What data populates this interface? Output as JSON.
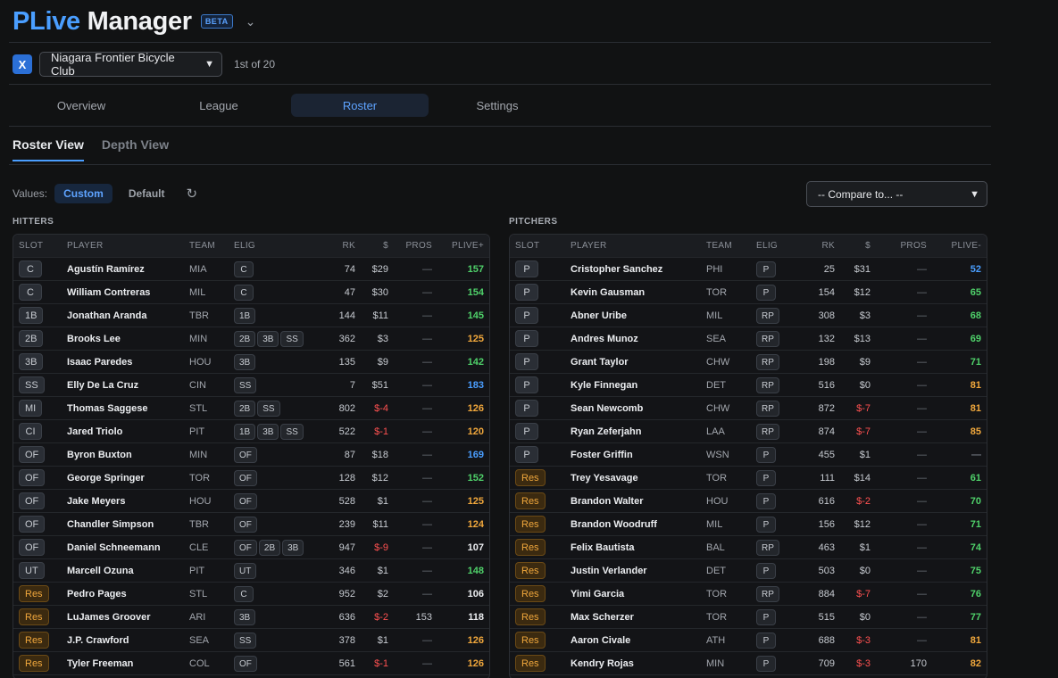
{
  "app": {
    "title_part1": "PLive",
    "title_part2": "Manager",
    "badge": "BETA"
  },
  "league": {
    "icon": "X",
    "name": "Niagara Frontier Bicycle Club",
    "rank": "1st of 20"
  },
  "tabs": [
    "Overview",
    "League",
    "Roster",
    "Settings"
  ],
  "active_tab": "Roster",
  "subtabs": [
    "Roster View",
    "Depth View"
  ],
  "values": {
    "label": "Values:",
    "custom": "Custom",
    "default": "Default"
  },
  "compare": {
    "label": "-- Compare to... --"
  },
  "hitters": {
    "title": "HITTERS",
    "headers": [
      "SLOT",
      "PLAYER",
      "TEAM",
      "ELIG",
      "RK",
      "$",
      "PROS",
      "PLIVE+"
    ],
    "rows": [
      {
        "slot": "C",
        "player": "Agustín Ramírez",
        "team": "MIA",
        "elig": [
          "C"
        ],
        "rk": "74",
        "price": "$29",
        "pros": "—",
        "plive": "157",
        "color": "#4fd16a"
      },
      {
        "slot": "C",
        "player": "William Contreras",
        "team": "MIL",
        "elig": [
          "C"
        ],
        "rk": "47",
        "price": "$30",
        "pros": "—",
        "plive": "154",
        "color": "#4fd16a"
      },
      {
        "slot": "1B",
        "player": "Jonathan Aranda",
        "team": "TBR",
        "elig": [
          "1B"
        ],
        "rk": "144",
        "price": "$11",
        "pros": "—",
        "plive": "145",
        "color": "#4fd16a"
      },
      {
        "slot": "2B",
        "player": "Brooks Lee",
        "team": "MIN",
        "elig": [
          "2B",
          "3B",
          "SS"
        ],
        "rk": "362",
        "price": "$3",
        "pros": "—",
        "plive": "125",
        "color": "#f0a73c"
      },
      {
        "slot": "3B",
        "player": "Isaac Paredes",
        "team": "HOU",
        "elig": [
          "3B"
        ],
        "rk": "135",
        "price": "$9",
        "pros": "—",
        "plive": "142",
        "color": "#4fd16a"
      },
      {
        "slot": "SS",
        "player": "Elly De La Cruz",
        "team": "CIN",
        "elig": [
          "SS"
        ],
        "rk": "7",
        "price": "$51",
        "pros": "—",
        "plive": "183",
        "color": "#4a9eff"
      },
      {
        "slot": "MI",
        "player": "Thomas Saggese",
        "team": "STL",
        "elig": [
          "2B",
          "SS"
        ],
        "rk": "802",
        "price": "$-4",
        "pros": "—",
        "plive": "126",
        "color": "#f0a73c"
      },
      {
        "slot": "CI",
        "player": "Jared Triolo",
        "team": "PIT",
        "elig": [
          "1B",
          "3B",
          "SS"
        ],
        "rk": "522",
        "price": "$-1",
        "pros": "—",
        "plive": "120",
        "color": "#f0a73c"
      },
      {
        "slot": "OF",
        "player": "Byron Buxton",
        "team": "MIN",
        "elig": [
          "OF"
        ],
        "rk": "87",
        "price": "$18",
        "pros": "—",
        "plive": "169",
        "color": "#4a9eff"
      },
      {
        "slot": "OF",
        "player": "George Springer",
        "team": "TOR",
        "elig": [
          "OF"
        ],
        "rk": "128",
        "price": "$12",
        "pros": "—",
        "plive": "152",
        "color": "#4fd16a"
      },
      {
        "slot": "OF",
        "player": "Jake Meyers",
        "team": "HOU",
        "elig": [
          "OF"
        ],
        "rk": "528",
        "price": "$1",
        "pros": "—",
        "plive": "125",
        "color": "#f0a73c"
      },
      {
        "slot": "OF",
        "player": "Chandler Simpson",
        "team": "TBR",
        "elig": [
          "OF"
        ],
        "rk": "239",
        "price": "$11",
        "pros": "—",
        "plive": "124",
        "color": "#f0a73c"
      },
      {
        "slot": "OF",
        "player": "Daniel Schneemann",
        "team": "CLE",
        "elig": [
          "OF",
          "2B",
          "3B"
        ],
        "rk": "947",
        "price": "$-9",
        "pros": "—",
        "plive": "107",
        "color": "#eceef1"
      },
      {
        "slot": "UT",
        "player": "Marcell Ozuna",
        "team": "PIT",
        "elig": [
          "UT"
        ],
        "rk": "346",
        "price": "$1",
        "pros": "—",
        "plive": "148",
        "color": "#4fd16a"
      },
      {
        "slot": "Res",
        "player": "Pedro Pages",
        "team": "STL",
        "elig": [
          "C"
        ],
        "rk": "952",
        "price": "$2",
        "pros": "—",
        "plive": "106",
        "color": "#eceef1"
      },
      {
        "slot": "Res",
        "player": "LuJames Groover",
        "team": "ARI",
        "elig": [
          "3B"
        ],
        "rk": "636",
        "price": "$-2",
        "pros": "153",
        "plive": "118",
        "color": "#eceef1"
      },
      {
        "slot": "Res",
        "player": "J.P. Crawford",
        "team": "SEA",
        "elig": [
          "SS"
        ],
        "rk": "378",
        "price": "$1",
        "pros": "—",
        "plive": "126",
        "color": "#f0a73c"
      },
      {
        "slot": "Res",
        "player": "Tyler Freeman",
        "team": "COL",
        "elig": [
          "OF"
        ],
        "rk": "561",
        "price": "$-1",
        "pros": "—",
        "plive": "126",
        "color": "#f0a73c"
      }
    ]
  },
  "pitchers": {
    "title": "PITCHERS",
    "headers": [
      "SLOT",
      "PLAYER",
      "TEAM",
      "ELIG",
      "RK",
      "$",
      "PROS",
      "PLIVE-"
    ],
    "rows": [
      {
        "slot": "P",
        "player": "Cristopher Sanchez",
        "team": "PHI",
        "elig": [
          "P"
        ],
        "rk": "25",
        "price": "$31",
        "pros": "—",
        "plive": "52",
        "color": "#4a9eff"
      },
      {
        "slot": "P",
        "player": "Kevin Gausman",
        "team": "TOR",
        "elig": [
          "P"
        ],
        "rk": "154",
        "price": "$12",
        "pros": "—",
        "plive": "65",
        "color": "#4fd16a"
      },
      {
        "slot": "P",
        "player": "Abner Uribe",
        "team": "MIL",
        "elig": [
          "RP"
        ],
        "rk": "308",
        "price": "$3",
        "pros": "—",
        "plive": "68",
        "color": "#4fd16a"
      },
      {
        "slot": "P",
        "player": "Andres Munoz",
        "team": "SEA",
        "elig": [
          "RP"
        ],
        "rk": "132",
        "price": "$13",
        "pros": "—",
        "plive": "69",
        "color": "#4fd16a"
      },
      {
        "slot": "P",
        "player": "Grant Taylor",
        "team": "CHW",
        "elig": [
          "RP"
        ],
        "rk": "198",
        "price": "$9",
        "pros": "—",
        "plive": "71",
        "color": "#4fd16a"
      },
      {
        "slot": "P",
        "player": "Kyle Finnegan",
        "team": "DET",
        "elig": [
          "RP"
        ],
        "rk": "516",
        "price": "$0",
        "pros": "—",
        "plive": "81",
        "color": "#f0a73c"
      },
      {
        "slot": "P",
        "player": "Sean Newcomb",
        "team": "CHW",
        "elig": [
          "RP"
        ],
        "rk": "872",
        "price": "$-7",
        "pros": "—",
        "plive": "81",
        "color": "#f0a73c"
      },
      {
        "slot": "P",
        "player": "Ryan Zeferjahn",
        "team": "LAA",
        "elig": [
          "RP"
        ],
        "rk": "874",
        "price": "$-7",
        "pros": "—",
        "plive": "85",
        "color": "#f0a73c"
      },
      {
        "slot": "P",
        "player": "Foster Griffin",
        "team": "WSN",
        "elig": [
          "P"
        ],
        "rk": "455",
        "price": "$1",
        "pros": "—",
        "plive": "—",
        "color": "#6e737b"
      },
      {
        "slot": "Res",
        "player": "Trey Yesavage",
        "team": "TOR",
        "elig": [
          "P"
        ],
        "rk": "111",
        "price": "$14",
        "pros": "—",
        "plive": "61",
        "color": "#4fd16a"
      },
      {
        "slot": "Res",
        "player": "Brandon Walter",
        "team": "HOU",
        "elig": [
          "P"
        ],
        "rk": "616",
        "price": "$-2",
        "pros": "—",
        "plive": "70",
        "color": "#4fd16a"
      },
      {
        "slot": "Res",
        "player": "Brandon Woodruff",
        "team": "MIL",
        "elig": [
          "P"
        ],
        "rk": "156",
        "price": "$12",
        "pros": "—",
        "plive": "71",
        "color": "#4fd16a"
      },
      {
        "slot": "Res",
        "player": "Felix Bautista",
        "team": "BAL",
        "elig": [
          "RP"
        ],
        "rk": "463",
        "price": "$1",
        "pros": "—",
        "plive": "74",
        "color": "#4fd16a"
      },
      {
        "slot": "Res",
        "player": "Justin Verlander",
        "team": "DET",
        "elig": [
          "P"
        ],
        "rk": "503",
        "price": "$0",
        "pros": "—",
        "plive": "75",
        "color": "#4fd16a"
      },
      {
        "slot": "Res",
        "player": "Yimi Garcia",
        "team": "TOR",
        "elig": [
          "RP"
        ],
        "rk": "884",
        "price": "$-7",
        "pros": "—",
        "plive": "76",
        "color": "#4fd16a"
      },
      {
        "slot": "Res",
        "player": "Max Scherzer",
        "team": "TOR",
        "elig": [
          "P"
        ],
        "rk": "515",
        "price": "$0",
        "pros": "—",
        "plive": "77",
        "color": "#4fd16a"
      },
      {
        "slot": "Res",
        "player": "Aaron Civale",
        "team": "ATH",
        "elig": [
          "P"
        ],
        "rk": "688",
        "price": "$-3",
        "pros": "—",
        "plive": "81",
        "color": "#f0a73c"
      },
      {
        "slot": "Res",
        "player": "Kendry Rojas",
        "team": "MIN",
        "elig": [
          "P"
        ],
        "rk": "709",
        "price": "$-3",
        "pros": "170",
        "plive": "82",
        "color": "#f0a73c"
      }
    ]
  }
}
